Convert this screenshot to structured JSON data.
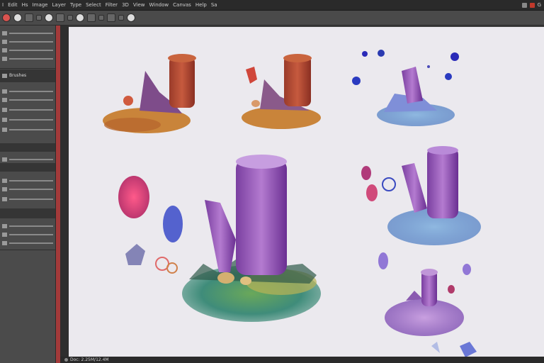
{
  "menubar": {
    "items": [
      "I",
      "Edit",
      "Hs",
      "Image",
      "Layer",
      "Type",
      "Select",
      "Filter",
      "3D",
      "View",
      "Window",
      "Canvas",
      "Help",
      "Sa"
    ],
    "right_text": "G",
    "colors": {
      "bg": "#2a2a2a",
      "close": "#c0392b"
    }
  },
  "toolbar": {
    "icons": [
      "brush-tool-icon",
      "eyedropper-icon",
      "brush-preset-icon",
      "zoom-icon",
      "grid-icon",
      "layers-icon",
      "opacity-icon",
      "flow-icon",
      "airbrush-icon",
      "smoothing-icon",
      "settings-icon",
      "pressure-icon",
      "symmetry-icon"
    ]
  },
  "panel": {
    "label": "Brushes",
    "accent": "#a33a3a"
  },
  "canvas": {
    "bg": "#ebe9ee",
    "assets": [
      "fungi-sprite-small-1",
      "fungi-sprite-small-2",
      "blue-fungi-sprite",
      "main-purple-pillar-sprite",
      "purple-pillars-blue-base",
      "small-purple-mushroom"
    ]
  },
  "statusbar": {
    "text": "Doc: 2.25M/12.4M"
  }
}
